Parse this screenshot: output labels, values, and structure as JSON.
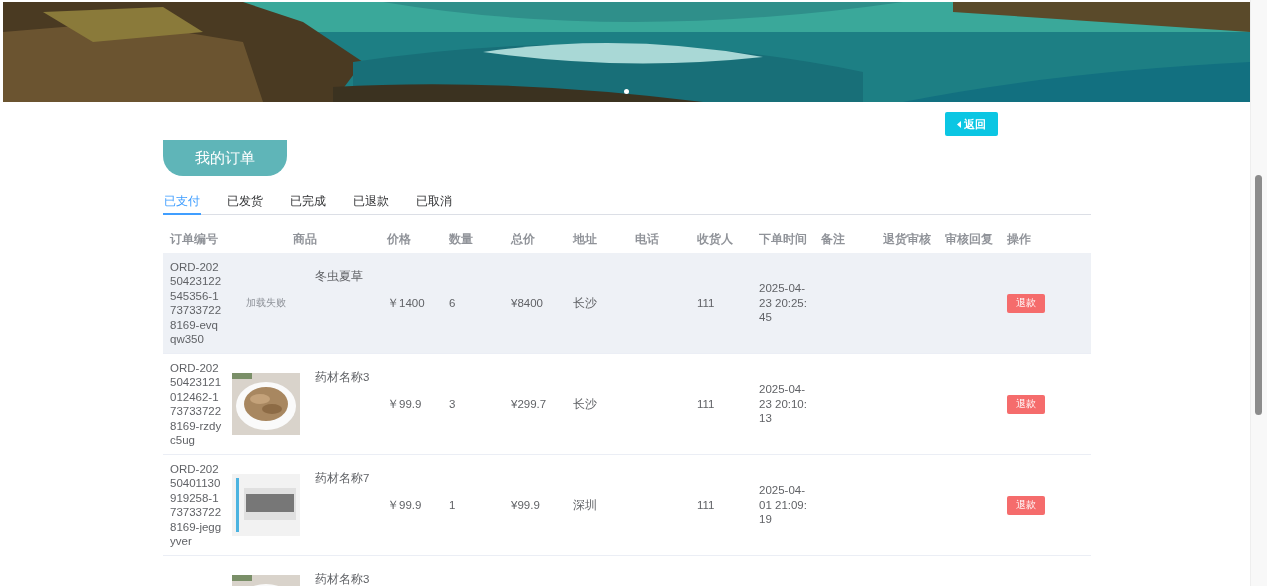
{
  "banner": {
    "kind": "picture",
    "dots": [
      {
        "selected": true
      }
    ]
  },
  "back_button": {
    "label": "返回"
  },
  "title": "我的订单",
  "tabs": [
    {
      "label": "已支付",
      "selected": true
    },
    {
      "label": "已发货",
      "selected": false
    },
    {
      "label": "已完成",
      "selected": false
    },
    {
      "label": "已退款",
      "selected": false
    },
    {
      "label": "已取消",
      "selected": false
    }
  ],
  "table": {
    "columns": [
      "订单编号",
      "商品",
      "价格",
      "数量",
      "总价",
      "地址",
      "电话",
      "收货人",
      "下单时间",
      "备注",
      "退货审核",
      "审核回复",
      "操作"
    ],
    "rows": [
      {
        "order_id": "ORD-20250423122545356-1737337228169-evqqw350",
        "image": {
          "kind": "failed",
          "text": "加载失败"
        },
        "product": "冬虫夏草",
        "price": "￥1400",
        "quantity": "6",
        "total": "¥8400",
        "address": "长沙",
        "receiver": "111",
        "time": "2025-04-23 20:25:45",
        "action": "退款",
        "highlighted": true
      },
      {
        "order_id": "ORD-20250423121012462-1737337228169-rzdyc5ug",
        "product": "药材名称3",
        "price": "￥99.9",
        "quantity": "3",
        "total": "¥299.7",
        "address": "长沙",
        "receiver": "111",
        "time": "2025-04-23 20:10:13",
        "action": "退款",
        "highlighted": false
      },
      {
        "order_id": "ORD-20250401130919258-1737337228169-jeggyver",
        "product": "药材名称7",
        "price": "￥99.9",
        "quantity": "1",
        "total": "¥99.9",
        "address": "深圳",
        "receiver": "111",
        "time": "2025-04-01 21:09:19",
        "action": "退款",
        "highlighted": false
      },
      {
        "product": "药材名称3",
        "highlighted": false
      }
    ]
  }
}
